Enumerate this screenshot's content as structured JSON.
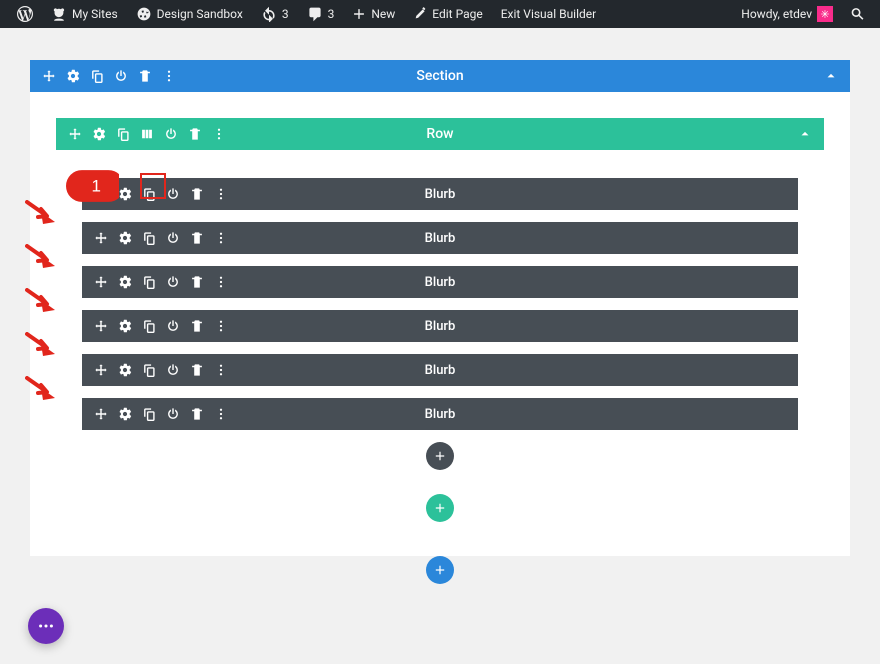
{
  "wp_bar": {
    "my_sites": "My Sites",
    "site_name": "Design Sandbox",
    "updates_count": "3",
    "comments_count": "3",
    "new_label": "New",
    "edit_page": "Edit Page",
    "exit_vb": "Exit Visual Builder",
    "howdy": "Howdy, etdev"
  },
  "section": {
    "label": "Section"
  },
  "row": {
    "label": "Row"
  },
  "modules": [
    {
      "label": "Blurb"
    },
    {
      "label": "Blurb"
    },
    {
      "label": "Blurb"
    },
    {
      "label": "Blurb"
    },
    {
      "label": "Blurb"
    },
    {
      "label": "Blurb"
    }
  ],
  "callout": {
    "number": "1"
  }
}
